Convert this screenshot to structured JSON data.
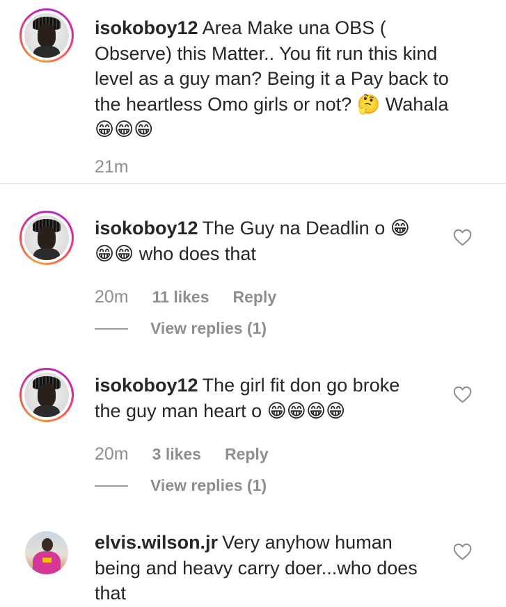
{
  "caption": {
    "username": "isokoboy12",
    "text": "Area Make una OBS ( Observe) this Matter.. You fit run this kind level as a guy man? Being it a Pay back to the heartless Omo girls or not? 🤔 Wahala 😁😁😁",
    "time": "21m"
  },
  "comments": [
    {
      "username": "isokoboy12",
      "text": "The Guy na Deadlin o 😁😁😁 who does that",
      "time": "20m",
      "likes": "11 likes",
      "reply_label": "Reply",
      "view_replies": "View replies (1)"
    },
    {
      "username": "isokoboy12",
      "text": "The girl fit don go broke the guy man heart o 😁😁😁😁",
      "time": "20m",
      "likes": "3 likes",
      "reply_label": "Reply",
      "view_replies": "View replies (1)"
    },
    {
      "username": "elvis.wilson.jr",
      "text": "Very anyhow human being and heavy carry doer...who does that"
    }
  ],
  "icons": {
    "like": "heart-outline-icon"
  },
  "colors": {
    "text": "#262626",
    "secondary": "#8e8e8e",
    "divider": "#e8e8e8",
    "story_ring": "#d6249f"
  }
}
